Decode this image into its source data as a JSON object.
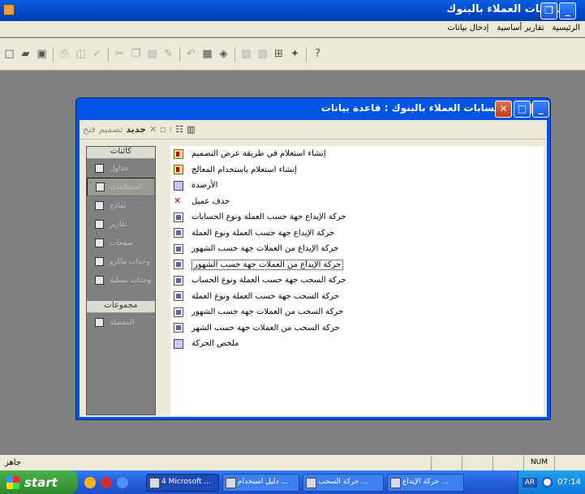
{
  "app": {
    "title": "حسابات العملاء بالبنوك"
  },
  "menu": {
    "items": [
      "الرئيسية",
      "تقارير أساسية",
      "إدخال بيانات"
    ]
  },
  "toolbar": {
    "icons": [
      "new-icon",
      "open-icon",
      "save-icon",
      "sep",
      "print-icon",
      "print-preview-icon",
      "spelling-icon",
      "sep",
      "cut-icon",
      "copy-icon",
      "paste-icon",
      "format-painter-icon",
      "sep",
      "undo-icon",
      "office-links-icon",
      "analyze-icon",
      "sep",
      "code-icon",
      "properties-icon",
      "relationships-icon",
      "new-object-icon",
      "sep",
      "help-icon"
    ]
  },
  "db_window": {
    "title": "حسابات العملاء بالبنوك : قاعدة بيانات",
    "toolbar": {
      "open": "فتح",
      "design": "تصميم",
      "new": "جديد"
    },
    "objects_header": "كائنات",
    "objects": [
      {
        "label": "جداول",
        "icon": "table-icon"
      },
      {
        "label": "استعلامات",
        "icon": "query-icon"
      },
      {
        "label": "نماذج",
        "icon": "form-icon"
      },
      {
        "label": "تقارير",
        "icon": "report-icon"
      },
      {
        "label": "صفحات",
        "icon": "page-icon"
      },
      {
        "label": "وحدات ماكرو",
        "icon": "macro-icon"
      },
      {
        "label": "وحدات نمطية",
        "icon": "module-icon"
      }
    ],
    "groups_header": "مجموعات",
    "groups": [
      {
        "label": "المفضلة",
        "icon": "favorites-icon"
      }
    ],
    "items": [
      {
        "label": "إنشاء استعلام في طريقة عرض التصميم",
        "icon": "wizard"
      },
      {
        "label": "إنشاء استعلام باستخدام المعالج",
        "icon": "wizard"
      },
      {
        "label": "الأرصدة",
        "icon": "multi"
      },
      {
        "label": "حذف عميل",
        "icon": "del"
      },
      {
        "label": "حركة الإيداع جهة حسب العملة ونوع الحسابات",
        "icon": "form"
      },
      {
        "label": "حركة الإيداع جهة حسب العملة ونوع العملة",
        "icon": "form"
      },
      {
        "label": "حركة الإيداع من العملات جهة حسب الشهور",
        "icon": "form"
      },
      {
        "label": "حركة الإيداع من العملات جهة حسب الشهور",
        "icon": "form",
        "focus": true
      },
      {
        "label": "حركة السحب جهة حسب العملة ونوع الحساب",
        "icon": "form"
      },
      {
        "label": "حركة السحب جهة حسب العملة ونوع العملة",
        "icon": "form"
      },
      {
        "label": "حركة السحب من العملات جهة حسب الشهور",
        "icon": "form"
      },
      {
        "label": "حركة السحب من العملات جهة حسب الشهر",
        "icon": "form"
      },
      {
        "label": "ملخص الحركة",
        "icon": "multi"
      }
    ]
  },
  "status": {
    "text": "جاهز",
    "num": "NUM"
  },
  "taskbar": {
    "start": "start",
    "tasks": [
      "4 Microsoft ...",
      "دليل استخدام ...",
      "حركة السحب ...",
      "حركة الإيداع ..."
    ],
    "lang": "AR",
    "time": "07:14"
  }
}
